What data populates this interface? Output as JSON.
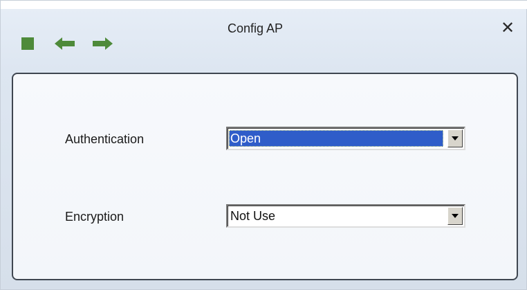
{
  "window": {
    "title": "Config AP",
    "close_glyph": "✕"
  },
  "toolbar": {
    "icons": [
      "stop-icon",
      "back-arrow-icon",
      "forward-arrow-icon"
    ],
    "accent_color": "#4e8a3a"
  },
  "form": {
    "authentication": {
      "label": "Authentication",
      "selected": "Open"
    },
    "encryption": {
      "label": "Encryption",
      "selected": "Not Use"
    }
  },
  "colors": {
    "selection": "#2f5dc9",
    "panel_border": "#3f4650"
  }
}
